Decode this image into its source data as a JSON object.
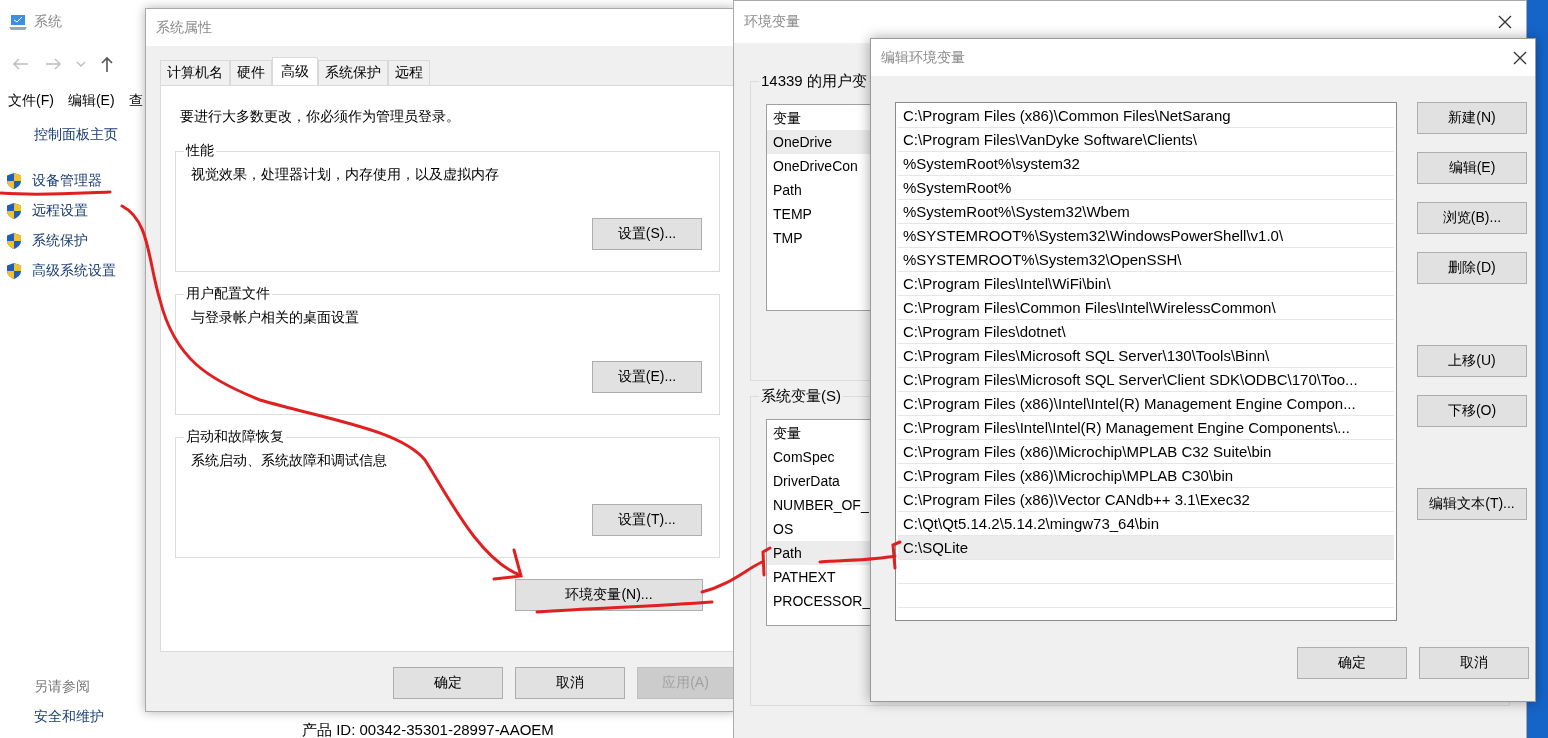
{
  "system_window": {
    "title": "系统",
    "menu": [
      "文件(F)",
      "编辑(E)",
      "查"
    ],
    "sidebar": {
      "home": "控制面板主页",
      "links": [
        "设备管理器",
        "远程设置",
        "系统保护",
        "高级系统设置"
      ],
      "see_also": "另请参阅",
      "see_also_links": [
        "安全和维护"
      ]
    },
    "product_id": "产品 ID: 00342-35301-28997-AAOEM"
  },
  "system_properties": {
    "title": "系统属性",
    "tabs": [
      {
        "label": "计算机名",
        "selected": false
      },
      {
        "label": "硬件",
        "selected": false
      },
      {
        "label": "高级",
        "selected": true
      },
      {
        "label": "系统保护",
        "selected": false
      },
      {
        "label": "远程",
        "selected": false
      }
    ],
    "notice": "要进行大多数更改，你必须作为管理员登录。",
    "groups": [
      {
        "title": "性能",
        "text": "视觉效果，处理器计划，内存使用，以及虚拟内存",
        "button": "设置(S)..."
      },
      {
        "title": "用户配置文件",
        "text": "与登录帐户相关的桌面设置",
        "button": "设置(E)..."
      },
      {
        "title": "启动和故障恢复",
        "text": "系统启动、系统故障和调试信息",
        "button": "设置(T)..."
      }
    ],
    "env_button": "环境变量(N)...",
    "buttons": [
      {
        "label": "确定",
        "disabled": false
      },
      {
        "label": "取消",
        "disabled": false
      },
      {
        "label": "应用(A)",
        "disabled": true
      }
    ]
  },
  "environment_variables": {
    "title": "环境变量",
    "user_group": {
      "title": "14339 的用户变",
      "header": "变量",
      "rows": [
        {
          "name": "OneDrive",
          "selected": true
        },
        {
          "name": "OneDriveCon",
          "selected": false
        },
        {
          "name": "Path",
          "selected": false
        },
        {
          "name": "TEMP",
          "selected": false
        },
        {
          "name": "TMP",
          "selected": false
        }
      ]
    },
    "system_group": {
      "title": "系统变量(S)",
      "header": "变量",
      "rows": [
        {
          "name": "ComSpec",
          "selected": false
        },
        {
          "name": "DriverData",
          "selected": false
        },
        {
          "name": "NUMBER_OF_",
          "selected": false
        },
        {
          "name": "OS",
          "selected": false
        },
        {
          "name": "Path",
          "selected": true
        },
        {
          "name": "PATHEXT",
          "selected": false
        },
        {
          "name": "PROCESSOR_",
          "selected": false
        }
      ]
    }
  },
  "edit_dialog": {
    "title": "编辑环境变量",
    "entries": [
      {
        "text": "C:\\Program Files (x86)\\Common Files\\NetSarang",
        "selected": false
      },
      {
        "text": "C:\\Program Files\\VanDyke Software\\Clients\\",
        "selected": false
      },
      {
        "text": "%SystemRoot%\\system32",
        "selected": false
      },
      {
        "text": "%SystemRoot%",
        "selected": false
      },
      {
        "text": "%SystemRoot%\\System32\\Wbem",
        "selected": false
      },
      {
        "text": "%SYSTEMROOT%\\System32\\WindowsPowerShell\\v1.0\\",
        "selected": false
      },
      {
        "text": "%SYSTEMROOT%\\System32\\OpenSSH\\",
        "selected": false
      },
      {
        "text": "C:\\Program Files\\Intel\\WiFi\\bin\\",
        "selected": false
      },
      {
        "text": "C:\\Program Files\\Common Files\\Intel\\WirelessCommon\\",
        "selected": false
      },
      {
        "text": "C:\\Program Files\\dotnet\\",
        "selected": false
      },
      {
        "text": "C:\\Program Files\\Microsoft SQL Server\\130\\Tools\\Binn\\",
        "selected": false
      },
      {
        "text": "C:\\Program Files\\Microsoft SQL Server\\Client SDK\\ODBC\\170\\Too...",
        "selected": false
      },
      {
        "text": "C:\\Program Files (x86)\\Intel\\Intel(R) Management Engine Compon...",
        "selected": false
      },
      {
        "text": "C:\\Program Files\\Intel\\Intel(R) Management Engine Components\\...",
        "selected": false
      },
      {
        "text": "C:\\Program Files (x86)\\Microchip\\MPLAB C32 Suite\\bin",
        "selected": false
      },
      {
        "text": "C:\\Program Files (x86)\\Microchip\\MPLAB C30\\bin",
        "selected": false
      },
      {
        "text": "C:\\Program Files (x86)\\Vector CANdb++ 3.1\\Exec32",
        "selected": false
      },
      {
        "text": "C:\\Qt\\Qt5.14.2\\5.14.2\\mingw73_64\\bin",
        "selected": false
      },
      {
        "text": "C:\\SQLite",
        "selected": true
      }
    ],
    "button_groups": [
      [
        "新建(N)",
        "编辑(E)",
        "浏览(B)...",
        "删除(D)"
      ],
      [
        "上移(U)",
        "下移(O)"
      ],
      [
        "编辑文本(T)..."
      ]
    ],
    "footer_buttons": [
      "确定",
      "取消"
    ]
  }
}
